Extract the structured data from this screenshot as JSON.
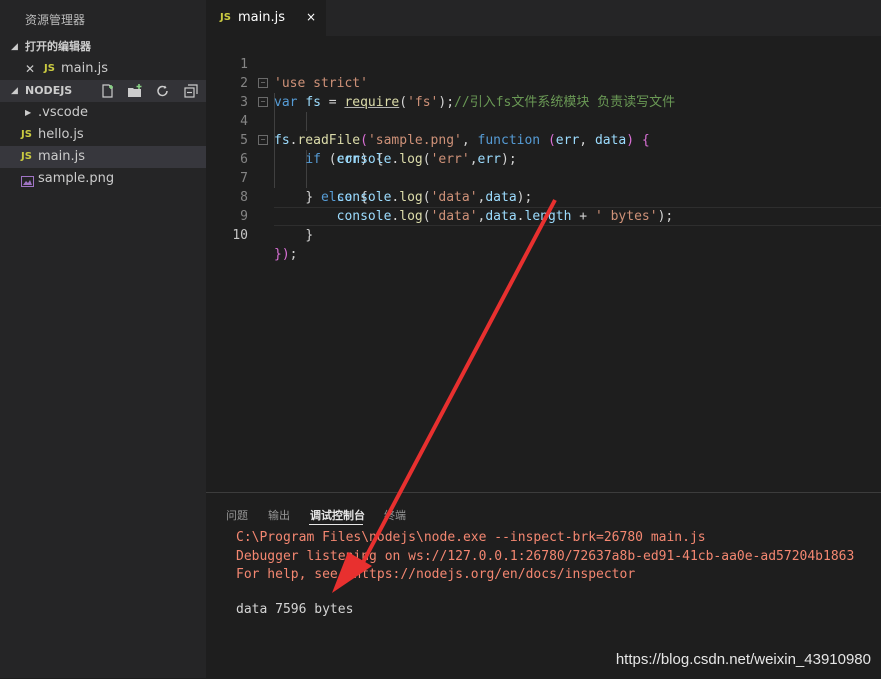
{
  "explorer": {
    "title": "资源管理器",
    "open_editors": {
      "label": "打开的编辑器",
      "items": [
        {
          "icon": "JS",
          "label": "main.js"
        }
      ]
    },
    "folder": {
      "label": "NODEJS",
      "items": [
        {
          "label": ".vscode"
        },
        {
          "icon": "JS",
          "label": "hello.js"
        },
        {
          "icon": "JS",
          "label": "main.js"
        },
        {
          "label": "sample.png"
        }
      ]
    }
  },
  "tab": {
    "icon": "JS",
    "label": "main.js",
    "close": "×"
  },
  "editor": {
    "line_numbers": [
      "1",
      "2",
      "3",
      "4",
      "5",
      "6",
      "7",
      "8",
      "9",
      "10"
    ],
    "lines": [
      "'use strict'",
      "var fs = require('fs');//引入fs文件系统模块 负责读写文件",
      "fs.readFile('sample.png', function (err, data) {",
      "    if (err) {",
      "        console.log('err',err);",
      "    } else {",
      "        console.log('data',data);",
      "        console.log('data',data.length + ' bytes');",
      "    }",
      "});"
    ]
  },
  "panel": {
    "tabs": [
      "问题",
      "输出",
      "调试控制台",
      "终端"
    ],
    "active_tab": "调试控制台",
    "output": [
      "C:\\Program Files\\nodejs\\node.exe --inspect-brk=26780 main.js",
      "Debugger listening on ws://127.0.0.1:26780/72637a8b-ed91-41cb-aa0e-ad57204b1863",
      "For help, see: https://nodejs.org/en/docs/inspector",
      "data 7596 bytes"
    ]
  },
  "watermark": "https://blog.csdn.net/weixin_43910980",
  "colors": {
    "annotation_arrow": "#e8302f",
    "js_icon": "#cbcb41",
    "error_output": "#f48771"
  }
}
